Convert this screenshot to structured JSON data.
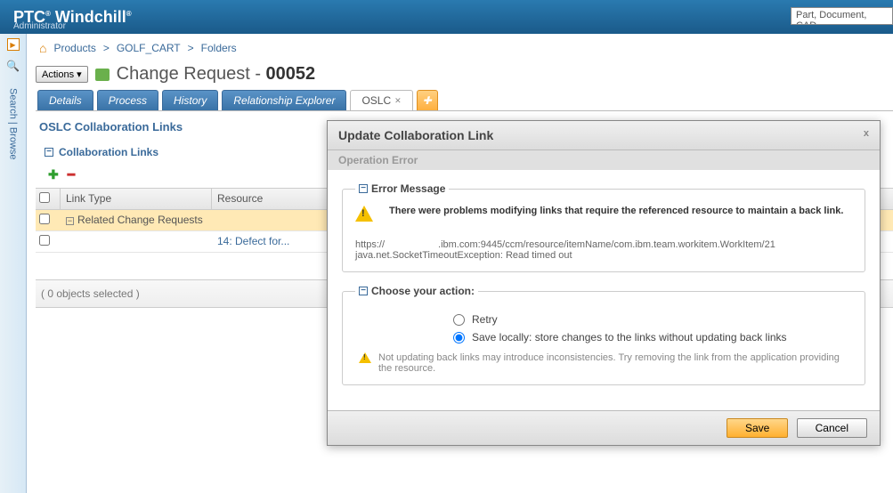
{
  "header": {
    "brand": "PTC",
    "product": "Windchill",
    "admin": "Administrator",
    "search_placeholder": "Part, Document, CAD"
  },
  "rail": {
    "label": "Search | Browse"
  },
  "breadcrumb": {
    "items": [
      "Products",
      "GOLF_CART",
      "Folders"
    ],
    "sep": ">"
  },
  "actions_label": "Actions",
  "page_title": {
    "prefix": "Change Request - ",
    "id": "00052"
  },
  "tabs": {
    "details": "Details",
    "process": "Process",
    "history": "History",
    "relexp": "Relationship Explorer",
    "oslc": "OSLC"
  },
  "section": {
    "title": "OSLC Collaboration Links",
    "subtitle": "Collaboration Links"
  },
  "table": {
    "headers": {
      "link_type": "Link Type",
      "resource": "Resource"
    },
    "rows": [
      {
        "type": "Related Change Requests",
        "resource": "",
        "selected": true,
        "tree": "collapse"
      },
      {
        "type": "",
        "resource": "14: Defect for...",
        "selected": false,
        "tree": "none"
      }
    ],
    "status": "( 0 objects selected )"
  },
  "dialog": {
    "title": "Update Collaboration Link",
    "subtitle": "Operation Error",
    "close": "x",
    "error": {
      "legend": "Error Message",
      "text": "There were problems modifying links that require the referenced resource to maintain a back link.",
      "url_prefix": "https://",
      "url_suffix": ".ibm.com:9445/ccm/resource/itemName/com.ibm.team.workitem.WorkItem/21",
      "exception": "java.net.SocketTimeoutException: Read timed out"
    },
    "action": {
      "legend": "Choose your action:",
      "retry": "Retry",
      "save_local": "Save locally: store changes to the links without updating back links",
      "note": "Not updating back links may introduce inconsistencies. Try removing the link from the application providing the resource."
    },
    "buttons": {
      "save": "Save",
      "cancel": "Cancel"
    }
  }
}
